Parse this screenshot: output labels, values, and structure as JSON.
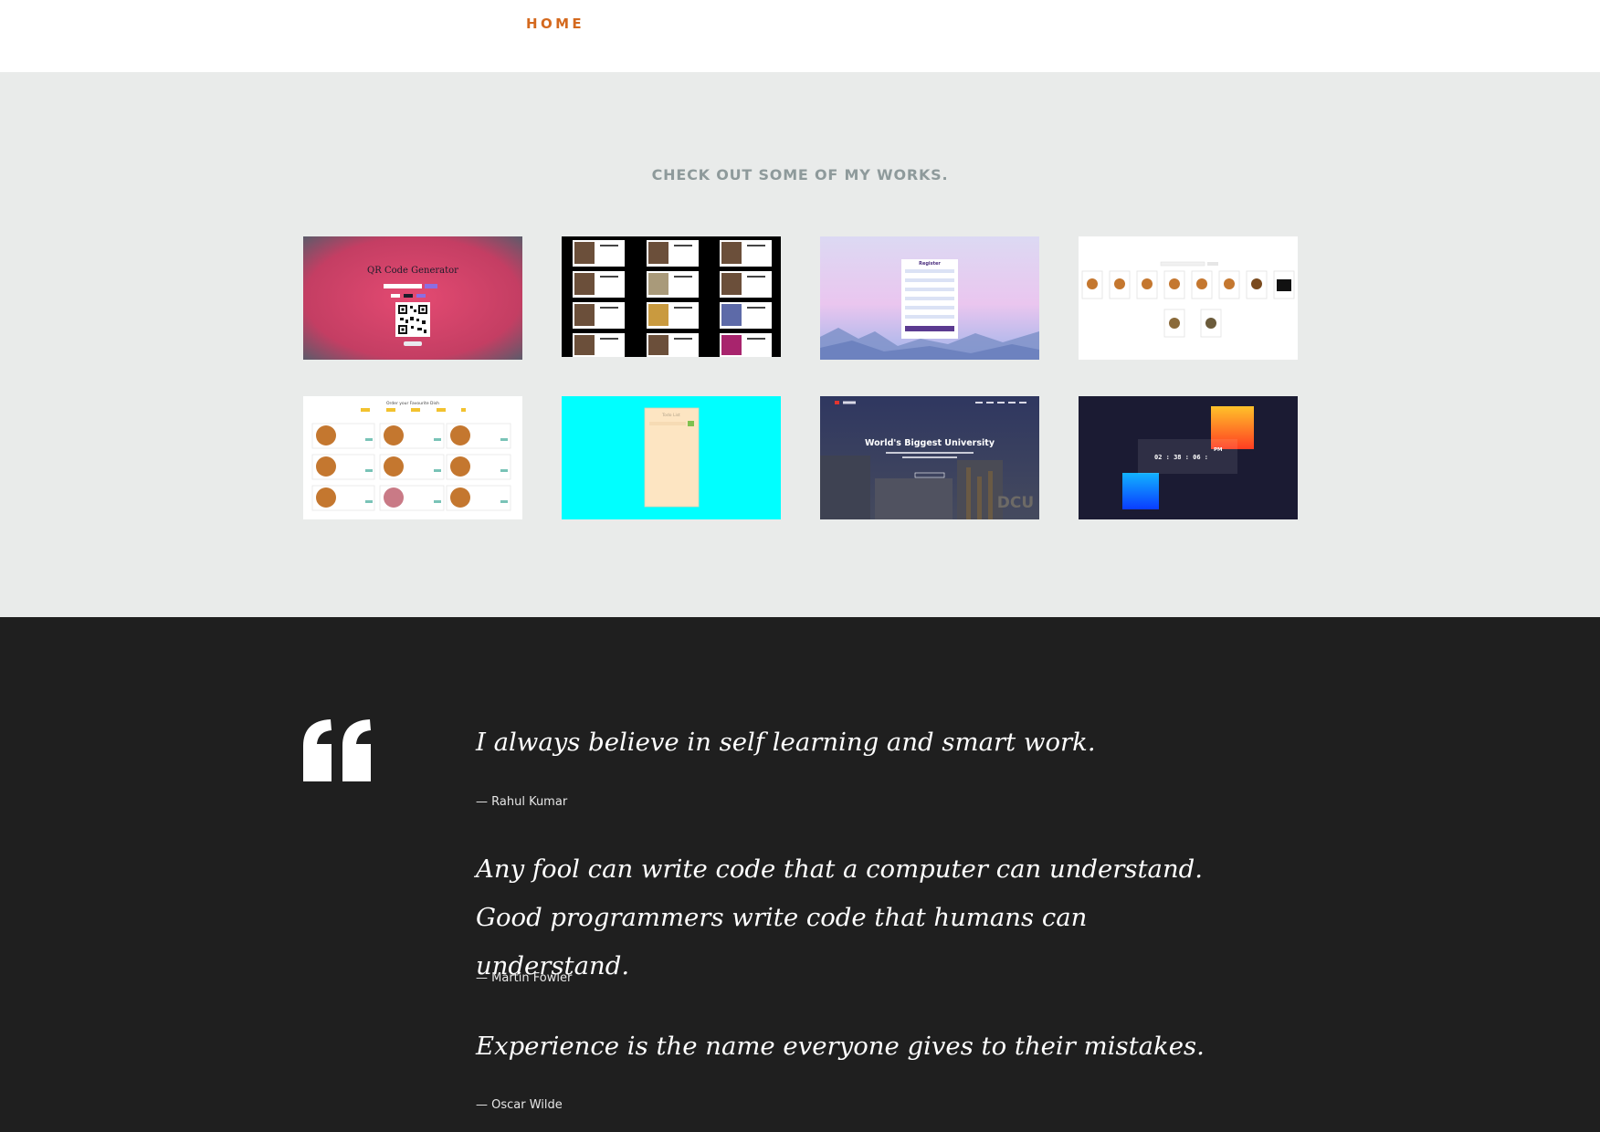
{
  "nav": {
    "home_label": "HOME",
    "accent_color": "#d4691e"
  },
  "works": {
    "title": "CHECK OUT SOME OF MY WORKS.",
    "items": [
      {
        "name": "qr-code-generator",
        "title": "QR Code Generator"
      },
      {
        "name": "github-profiles"
      },
      {
        "name": "register-form",
        "title": "Register"
      },
      {
        "name": "food-gallery"
      },
      {
        "name": "order-favourite-dish",
        "title": "Order your Favourite Dish"
      },
      {
        "name": "todo-list",
        "title": "Todo List"
      },
      {
        "name": "university-landing",
        "title": "World's Biggest University",
        "watermark": "DCU"
      },
      {
        "name": "countdown-clock",
        "clock": "02 : 38 : 06 :",
        "meridiem": "PM"
      }
    ]
  },
  "quotes": [
    {
      "text": "I always believe in self learning and smart work.",
      "author": "— Rahul Kumar"
    },
    {
      "text": "Any fool can write code that a computer can understand. Good programmers write code that humans can understand.",
      "author": "— Martin Fowler"
    },
    {
      "text": "Experience is the name everyone gives to their mistakes.",
      "author": "— Oscar Wilde"
    }
  ]
}
